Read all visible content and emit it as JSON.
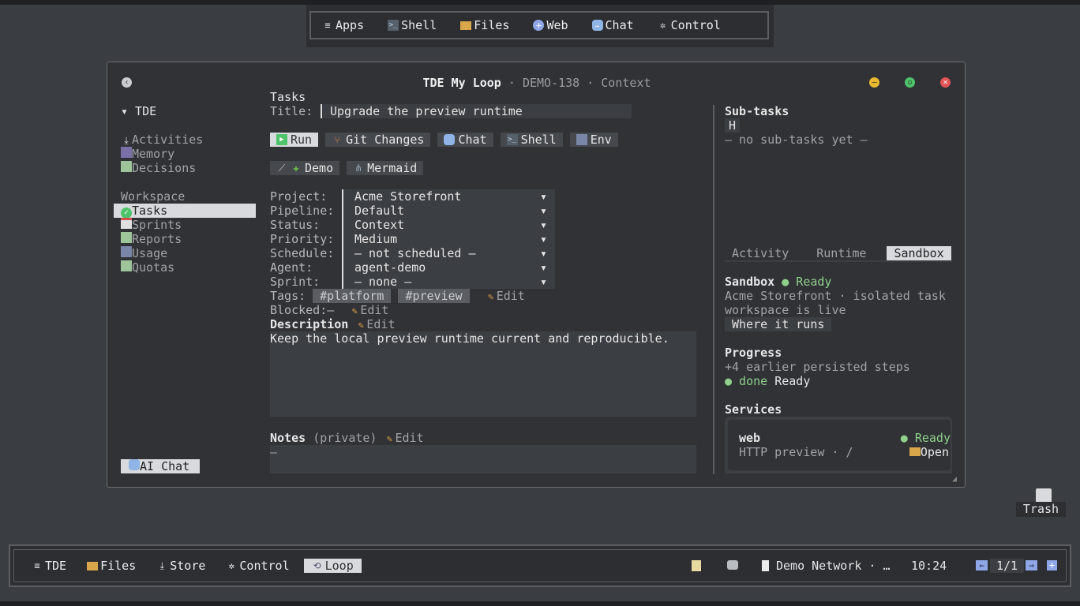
{
  "launcher": {
    "items": [
      {
        "icon": "menu-icon",
        "label": "Apps"
      },
      {
        "icon": "terminal-icon",
        "label": "Shell"
      },
      {
        "icon": "folder-icon",
        "label": "Files"
      },
      {
        "icon": "globe-icon",
        "label": "Web"
      },
      {
        "icon": "chat-icon",
        "label": "Chat"
      },
      {
        "icon": "gear-icon",
        "label": "Control"
      }
    ]
  },
  "window": {
    "title_app": "TDE My Loop",
    "title_sep1": " · ",
    "title_id": "DEMO-138",
    "title_sep2": " · ",
    "title_ctx": "Context"
  },
  "sidebar": {
    "root": "▾ TDE",
    "group1": [
      {
        "icon": "download-icon",
        "label": "Activities"
      },
      {
        "icon": "memory-icon",
        "label": "Memory"
      },
      {
        "icon": "checklist-icon",
        "label": "Decisions"
      }
    ],
    "workspace_label": "Workspace",
    "group2": [
      {
        "icon": "check-circle-icon",
        "label": "Tasks",
        "selected": true
      },
      {
        "icon": "calendar-icon",
        "label": "Sprints"
      },
      {
        "icon": "grid-icon",
        "label": "Reports"
      },
      {
        "icon": "bars-icon",
        "label": "Usage"
      },
      {
        "icon": "grid-icon",
        "label": "Quotas"
      }
    ],
    "ai_chat": "AI Chat"
  },
  "main": {
    "section": "Tasks",
    "title_label": "Title:",
    "title_value": "Upgrade the preview runtime",
    "actions": [
      "Run",
      "Git Changes",
      "Chat",
      "Shell",
      "Env"
    ],
    "actions2": [
      "Demo",
      "Mermaid"
    ],
    "fields": [
      {
        "label": "Project:",
        "value": "Acme Storefront"
      },
      {
        "label": "Pipeline:",
        "value": "Default"
      },
      {
        "label": "Status:",
        "value": "Context"
      },
      {
        "label": "Priority:",
        "value": "Medium"
      },
      {
        "label": "Schedule:",
        "value": "— not scheduled —"
      },
      {
        "label": "Agent:",
        "value": "agent-demo"
      },
      {
        "label": "Sprint:",
        "value": "— none —"
      }
    ],
    "dropdown_arrow": "▾",
    "tags_label": "Tags:",
    "tags": [
      "#platform",
      "#preview"
    ],
    "edit": "Edit",
    "blocked_label": "Blocked:",
    "blocked_value": "—",
    "description_label": "Description",
    "description_text": "Keep the local preview runtime current and reproducible.",
    "notes_label": "Notes",
    "notes_private": "(private)",
    "notes_value": "—"
  },
  "right": {
    "subtasks_title": "Sub-tasks",
    "subtasks_key": "H",
    "subtasks_empty": "— no sub-tasks yet —",
    "tabs": [
      "Activity",
      "Runtime",
      "Sandbox"
    ],
    "sandbox_title": "Sandbox",
    "sandbox_status": "● Ready",
    "sandbox_desc1": "Acme Storefront · isolated task",
    "sandbox_desc2": "workspace is live",
    "where_runs": "Where it runs",
    "progress_title": "Progress",
    "progress_earlier": "+4 earlier persisted steps",
    "progress_done": "● done",
    "progress_ready": "Ready",
    "services_title": "Services",
    "service_name": "web",
    "service_status": "● Ready",
    "service_desc": "HTTP preview · /",
    "service_open": "Open"
  },
  "desktop": {
    "trash": "Trash"
  },
  "taskbar": {
    "items": [
      {
        "icon": "menu-icon",
        "label": "TDE"
      },
      {
        "icon": "folder-icon",
        "label": "Files"
      },
      {
        "icon": "download-icon",
        "label": "Store"
      },
      {
        "icon": "gear-icon",
        "label": "Control"
      },
      {
        "icon": "loop-icon",
        "label": "Loop",
        "active": true
      }
    ],
    "network": "Demo Network · …",
    "clock": "10:24",
    "pager": "1/1"
  }
}
